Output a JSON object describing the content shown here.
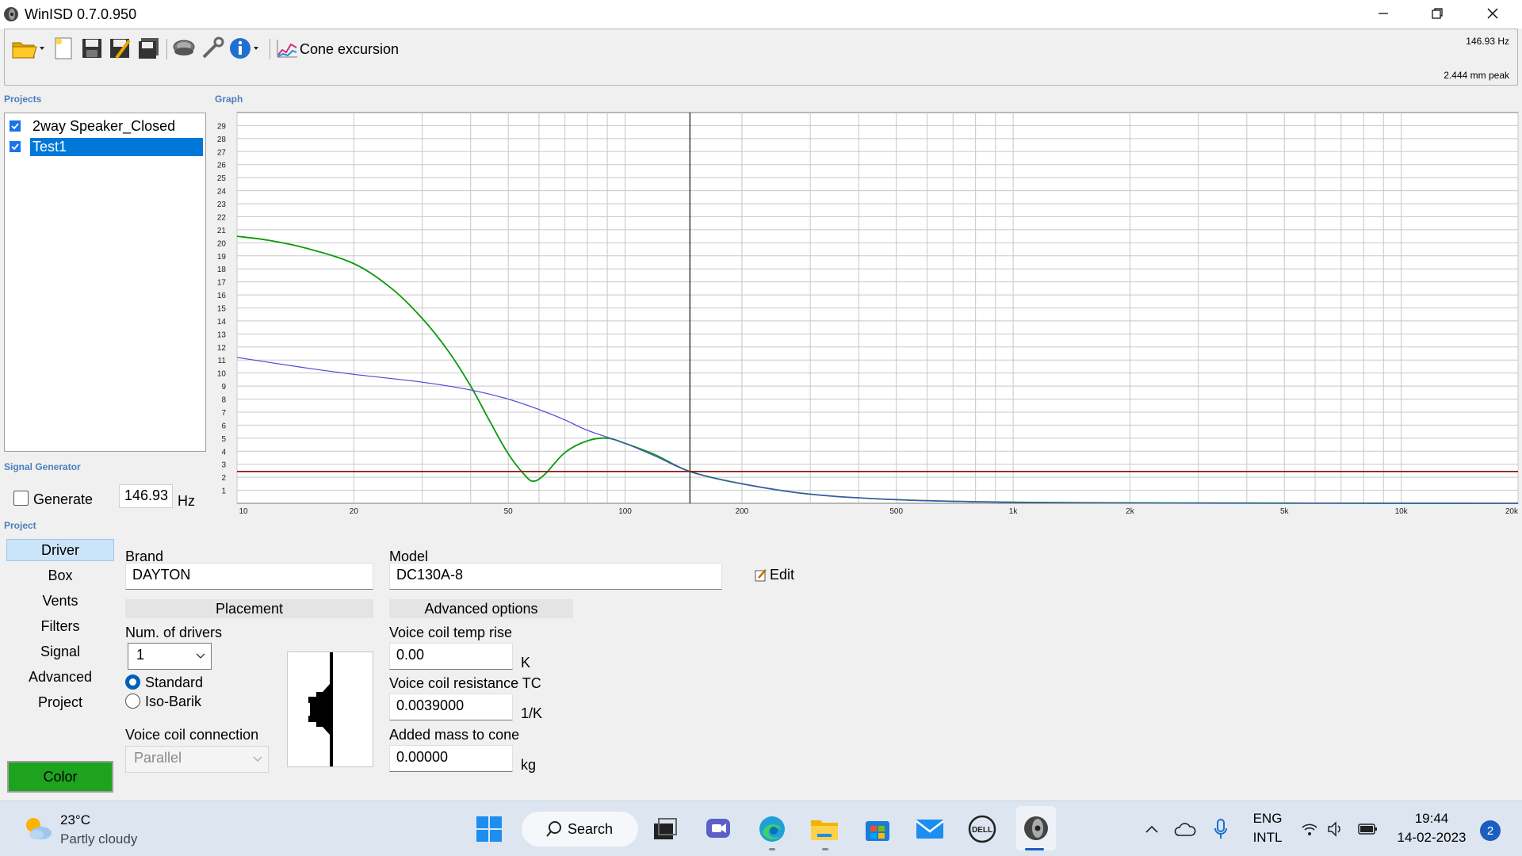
{
  "window": {
    "title": "WinISD 0.7.0.950"
  },
  "toolbar": {
    "graph_type_label": "Cone excursion",
    "freq_readout": "146.93 Hz",
    "excursion_readout": "2.444 mm peak",
    "icons": [
      "open-folder-icon",
      "new-file-icon",
      "save-icon",
      "save-as-icon",
      "save-all-icon",
      "driver-icon",
      "tools-icon",
      "info-icon",
      "chart-icon"
    ]
  },
  "sections": {
    "projects": "Projects",
    "graph": "Graph",
    "signal_generator": "Signal Generator",
    "project": "Project"
  },
  "projects": [
    {
      "name": "2way Speaker_Closed",
      "checked": true,
      "selected": false
    },
    {
      "name": "Test1",
      "checked": true,
      "selected": true
    }
  ],
  "chart_data": {
    "type": "line",
    "x_scale": "log",
    "xlim": [
      10,
      20000
    ],
    "ylim": [
      0,
      30
    ],
    "y_ticks": [
      "1",
      "2",
      "3",
      "4",
      "5",
      "6",
      "7",
      "8",
      "9",
      "10",
      "11",
      "12",
      "13",
      "14",
      "15",
      "16",
      "17",
      "18",
      "19",
      "20",
      "21",
      "22",
      "23",
      "24",
      "25",
      "26",
      "27",
      "28",
      "29"
    ],
    "x_ticks": [
      "10",
      "20",
      "50",
      "100",
      "200",
      "500",
      "1k",
      "2k",
      "5k",
      "10k",
      "20k"
    ],
    "grid": true,
    "cursor_x": 146.93,
    "series": [
      {
        "color": "#0a9a0a",
        "points": [
          [
            10,
            20.5
          ],
          [
            12,
            20.2
          ],
          [
            15,
            19.6
          ],
          [
            20,
            18.4
          ],
          [
            25,
            16.5
          ],
          [
            30,
            14.2
          ],
          [
            35,
            11.7
          ],
          [
            40,
            9
          ],
          [
            45,
            6.2
          ],
          [
            50,
            3.8
          ],
          [
            55,
            2.2
          ],
          [
            58,
            1.7
          ],
          [
            62,
            2.2
          ],
          [
            70,
            3.9
          ],
          [
            80,
            4.8
          ],
          [
            90,
            5
          ],
          [
            100,
            4.6
          ],
          [
            120,
            3.7
          ],
          [
            146.93,
            2.44
          ],
          [
            200,
            1.5
          ],
          [
            300,
            0.7
          ],
          [
            500,
            0.28
          ],
          [
            1000,
            0.08
          ],
          [
            2000,
            0.03
          ],
          [
            5000,
            0.01
          ],
          [
            20000,
            0
          ]
        ]
      },
      {
        "color": "#4848d8",
        "points": [
          [
            10,
            11.2
          ],
          [
            15,
            10.4
          ],
          [
            20,
            9.9
          ],
          [
            30,
            9.3
          ],
          [
            40,
            8.7
          ],
          [
            50,
            8
          ],
          [
            60,
            7.2
          ],
          [
            70,
            6.4
          ],
          [
            80,
            5.6
          ],
          [
            100,
            4.6
          ],
          [
            120,
            3.6
          ],
          [
            146.93,
            2.44
          ],
          [
            200,
            1.5
          ],
          [
            300,
            0.7
          ],
          [
            500,
            0.28
          ],
          [
            1000,
            0.08
          ],
          [
            5000,
            0.01
          ],
          [
            20000,
            0
          ]
        ]
      },
      {
        "color": "#8b1a1a",
        "points": [
          [
            10,
            2.44
          ],
          [
            20000,
            2.44
          ]
        ]
      }
    ]
  },
  "signal_generator": {
    "generate_label": "Generate",
    "frequency": "146.93",
    "unit": "Hz"
  },
  "nav": [
    "Driver",
    "Box",
    "Vents",
    "Filters",
    "Signal",
    "Advanced",
    "Project"
  ],
  "color_button": "Color",
  "driver": {
    "brand_label": "Brand",
    "brand_value": "DAYTON",
    "model_label": "Model",
    "model_value": "DC130A-8",
    "edit_label": "Edit",
    "placement_header": "Placement",
    "num_drivers_label": "Num. of drivers",
    "num_drivers_value": "1",
    "standard_label": "Standard",
    "isobarik_label": "Iso-Barik",
    "vc_connection_label": "Voice coil connection",
    "vc_connection_value": "Parallel",
    "advanced_header": "Advanced options",
    "vc_temp_label": "Voice coil temp rise",
    "vc_temp_value": "0.00",
    "vc_temp_unit": "K",
    "vc_res_label": "Voice coil resistance TC",
    "vc_res_value": "0.0039000",
    "vc_res_unit": "1/K",
    "added_mass_label": "Added mass to cone",
    "added_mass_value": "0.00000",
    "added_mass_unit": "kg"
  },
  "taskbar": {
    "weather_temp": "23°C",
    "weather_cond": "Partly cloudy",
    "search_label": "Search",
    "lang_top": "ENG",
    "lang_bottom": "INTL",
    "time": "19:44",
    "date": "14-02-2023",
    "notifications": "2"
  }
}
